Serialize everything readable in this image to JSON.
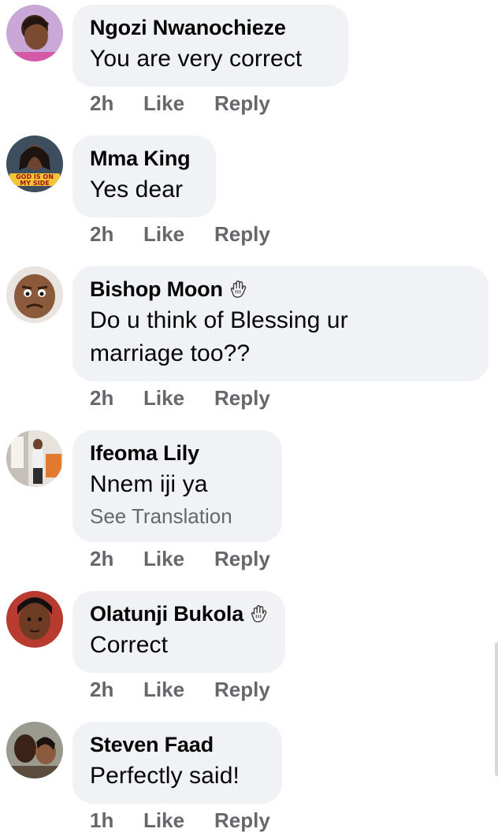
{
  "comments": [
    {
      "name": "Ngozi Nwanochieze",
      "text": "You are very correct",
      "time": "2h",
      "like": "Like",
      "reply": "Reply",
      "avatar_text": ""
    },
    {
      "name": "Mma King",
      "text": "Yes dear",
      "time": "2h",
      "like": "Like",
      "reply": "Reply",
      "avatar_text": "GOD IS ON MY SIDE"
    },
    {
      "name": "Bishop Moon",
      "text": "Do u think of Blessing ur marriage too??",
      "time": "2h",
      "like": "Like",
      "reply": "Reply",
      "badge": "wave-hand-icon"
    },
    {
      "name": "Ifeoma Lily",
      "text": "Nnem iji ya",
      "see_translation": "See Translation",
      "time": "2h",
      "like": "Like",
      "reply": "Reply"
    },
    {
      "name": "Olatunji Bukola",
      "text": "Correct",
      "time": "2h",
      "like": "Like",
      "reply": "Reply",
      "badge": "wave-hand-icon"
    },
    {
      "name": "Steven Faad",
      "text": "Perfectly said!",
      "time": "1h",
      "like": "Like",
      "reply": "Reply"
    }
  ],
  "colors": {
    "bubble": "#f0f2f5",
    "meta_text": "#65676b",
    "primary_text": "#050505"
  }
}
